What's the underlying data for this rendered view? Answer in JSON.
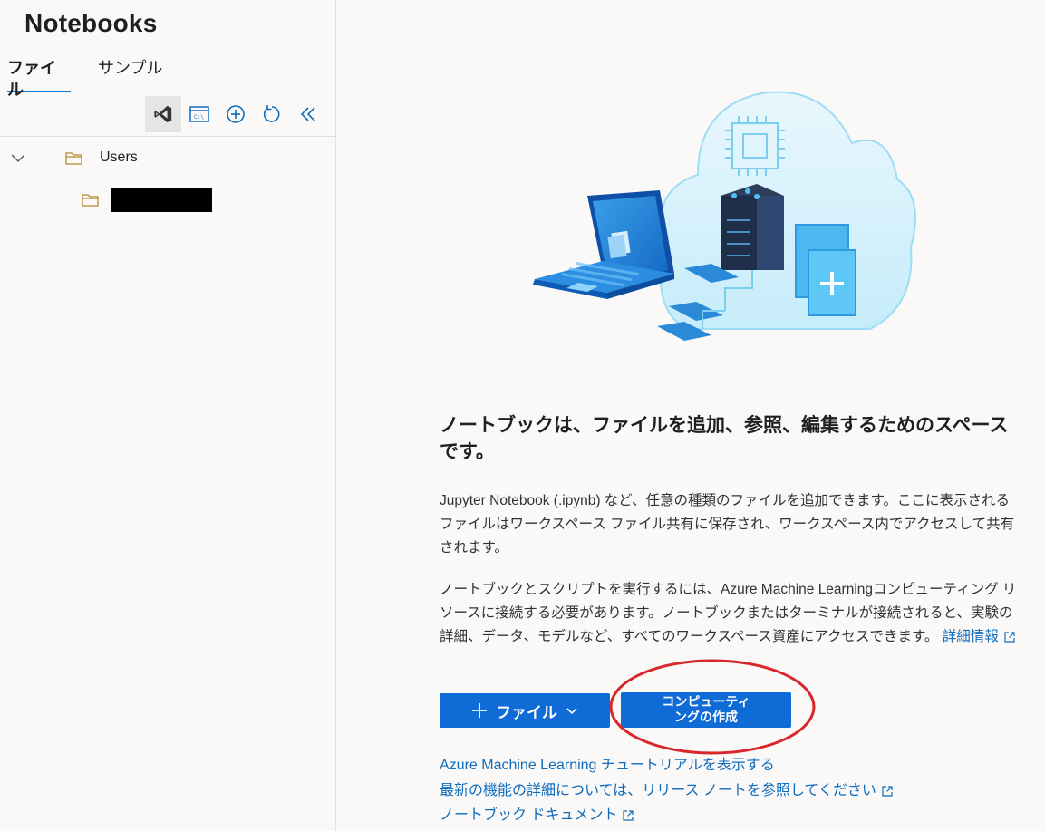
{
  "sidebar": {
    "title": "Notebooks",
    "tabs": [
      {
        "label": "ファイル",
        "active": true
      },
      {
        "label": "サンプル",
        "active": false
      }
    ],
    "toolbar_icons": [
      "vscode-icon",
      "terminal-icon",
      "add-icon",
      "refresh-icon",
      "collapse-icon"
    ],
    "tree": {
      "root": {
        "label": "Users",
        "expanded": true
      },
      "child": {
        "label": "",
        "redacted": true
      }
    }
  },
  "main": {
    "heading": "ノートブックは、ファイルを追加、参照、編集するためのスペースです。",
    "para1": "Jupyter Notebook (.ipynb) など、任意の種類のファイルを追加できます。ここに表示されるファイルはワークスペース ファイル共有に保存され、ワークスペース内でアクセスして共有されます。",
    "para2": "ノートブックとスクリプトを実行するには、Azure Machine Learningコンピューティング リソースに接続する必要があります。ノートブックまたはターミナルが接続されると、実験の詳細、データ、モデルなど、すべてのワークスペース資産にアクセスできます。",
    "learn_more": "詳細情報",
    "file_button": "ファイル",
    "create_compute_line1": "コンピューティ",
    "create_compute_line2": "ングの作成",
    "links": {
      "tutorial": "Azure Machine Learning チュートリアルを表示する",
      "release_notes": "最新の機能の詳細については、リリース ノートを参照してください",
      "docs": "ノートブック ドキュメント"
    }
  },
  "colors": {
    "accent": "#0f6cd6",
    "link": "#0f6cbd",
    "annotation": "#d9262a"
  }
}
